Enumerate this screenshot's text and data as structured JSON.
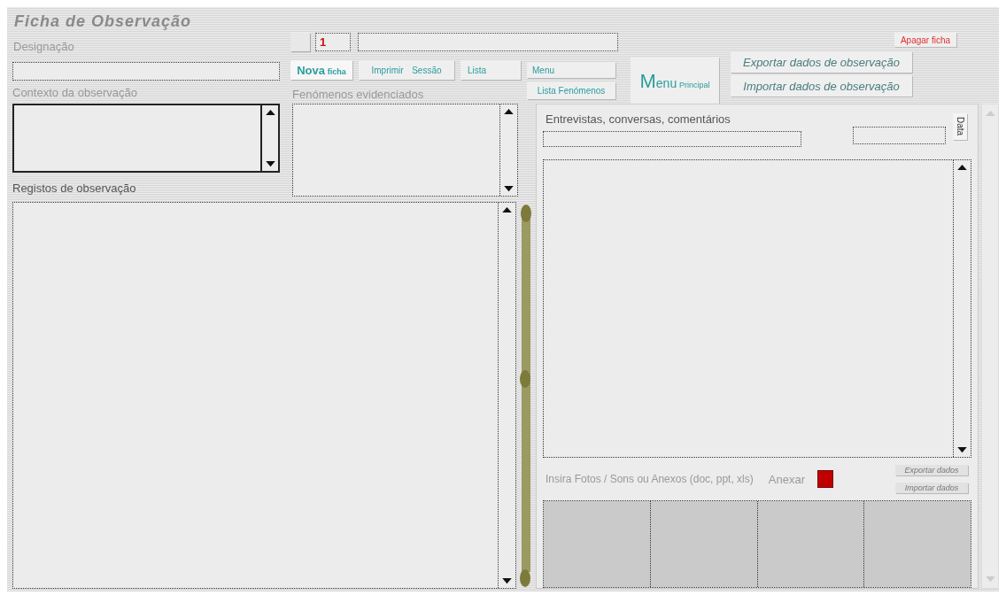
{
  "title": "Ficha de Observação",
  "labels": {
    "designacao": "Designação",
    "contexto": "Contexto da observação",
    "fenomenos": "Fenómenos evidenciados",
    "registos": "Registos de observação"
  },
  "record_number": "1",
  "nova_ficha": {
    "main": "Nova",
    "small": "ficha"
  },
  "imprimir": "Imprimir  Sessão",
  "lista": "Lista",
  "menu": "Menu",
  "lista_fenomenos": "Lista Fenómenos",
  "menu_principal": {
    "initial": "M",
    "rest": "enu",
    "small": "Principal"
  },
  "exportar_obs": "Exportar dados de observação",
  "importar_obs": "Importar dados de observação",
  "apagar": "Apagar ficha",
  "entrevistas": {
    "label": "Entrevistas, conversas, comentários",
    "date_button": "Data"
  },
  "anexos": {
    "label": "Insira Fotos / Sons ou Anexos (doc, ppt, xls)",
    "anexar": "Anexar",
    "exportar": "Exportar dados",
    "importar": "Importar dados",
    "slots": [
      {
        "kind": "empty"
      },
      {
        "kind": "empty"
      },
      {
        "kind": "empty"
      },
      {
        "kind": "empty"
      }
    ]
  }
}
